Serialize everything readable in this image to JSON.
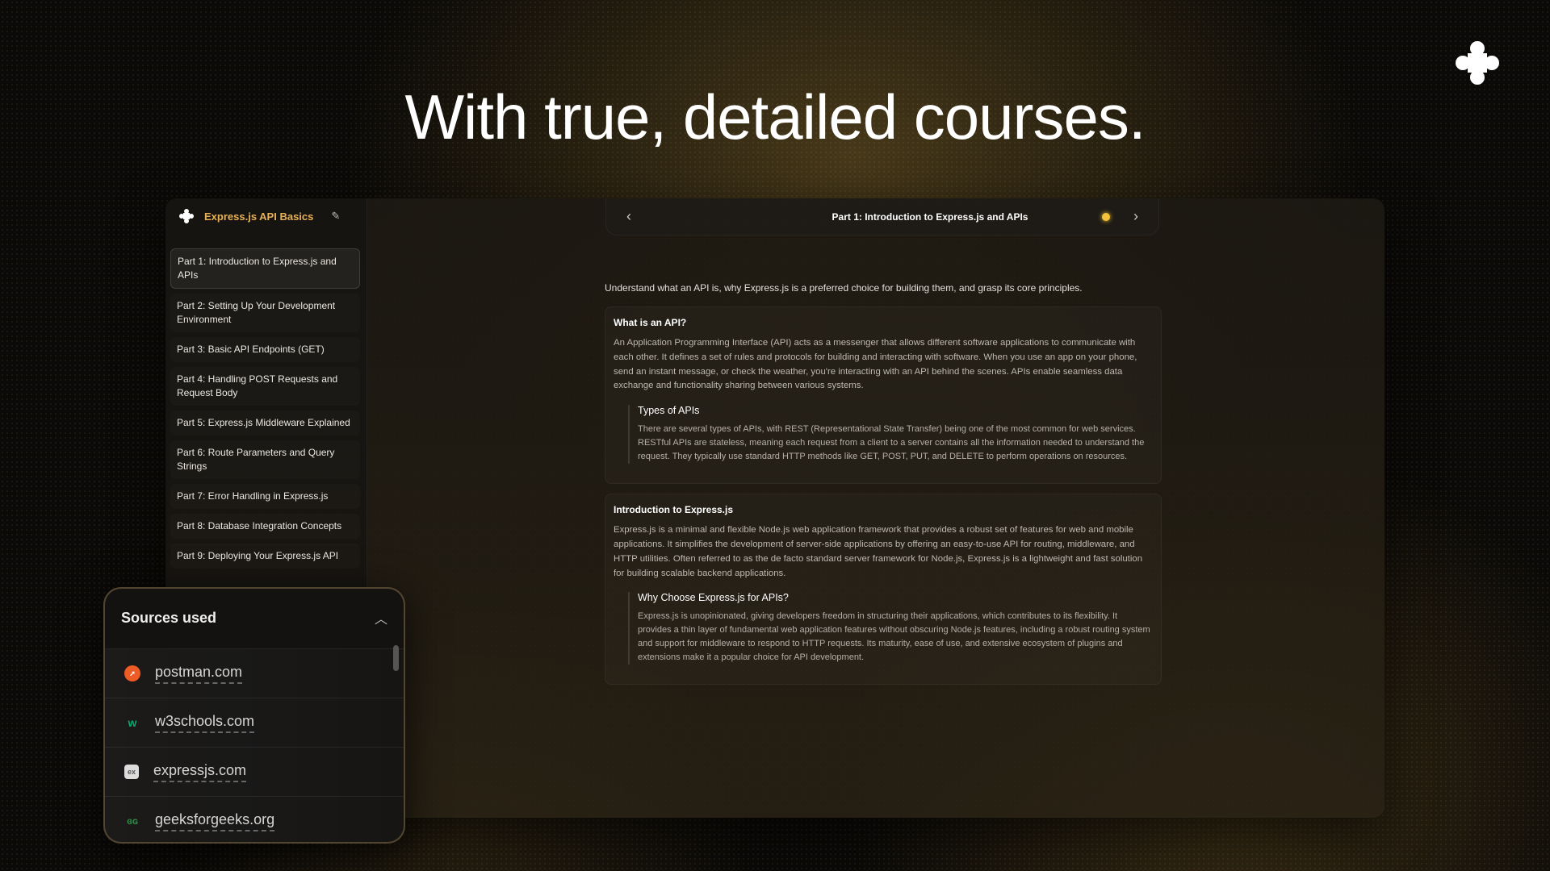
{
  "headline": "With true, detailed courses.",
  "brand": {
    "logo_icon": "four-petal-logo-icon"
  },
  "colors": {
    "accent": "#e7b057",
    "bulb": "#f4c33a",
    "postman": "#ef5b25",
    "w3schools": "#04aa6d",
    "gfg": "#2f8d46"
  },
  "sidebar": {
    "course_title": "Express.js API Basics",
    "edit_icon": "pencil-icon",
    "parts": [
      "Part 1: Introduction to Express.js and APIs",
      "Part 2: Setting Up Your Development Environment",
      "Part 3: Basic API Endpoints (GET)",
      "Part 4: Handling POST Requests and Request Body",
      "Part 5: Express.js Middleware Explained",
      "Part 6: Route Parameters and Query Strings",
      "Part 7: Error Handling in Express.js",
      "Part 8: Database Integration Concepts",
      "Part 9: Deploying Your Express.js API"
    ]
  },
  "topbar": {
    "title": "Part 1: Introduction to Express.js and APIs"
  },
  "content": {
    "intro": "Understand what an API is, why Express.js is a preferred choice for building them, and grasp its core principles.",
    "sections": [
      {
        "title": "What is an API?",
        "body": "An Application Programming Interface (API) acts as a messenger that allows different software applications to communicate with each other. It defines a set of rules and protocols for building and interacting with software. When you use an app on your phone, send an instant message, or check the weather, you're interacting with an API behind the scenes. APIs enable seamless data exchange and functionality sharing between various systems.",
        "sub_title": "Types of APIs",
        "sub_body": "There are several types of APIs, with REST (Representational State Transfer) being one of the most common for web services. RESTful APIs are stateless, meaning each request from a client to a server contains all the information needed to understand the request. They typically use standard HTTP methods like GET, POST, PUT, and DELETE to perform operations on resources."
      },
      {
        "title": "Introduction to Express.js",
        "body": "Express.js is a minimal and flexible Node.js web application framework that provides a robust set of features for web and mobile applications. It simplifies the development of server-side applications by offering an easy-to-use API for routing, middleware, and HTTP utilities. Often referred to as the de facto standard server framework for Node.js, Express.js is a lightweight and fast solution for building scalable backend applications.",
        "sub_title": "Why Choose Express.js for APIs?",
        "sub_body": "Express.js is unopinionated, giving developers freedom in structuring their applications, which contributes to its flexibility. It provides a thin layer of fundamental web application features without obscuring Node.js features, including a robust routing system and support for middleware to respond to HTTP requests. Its maturity, ease of use, and extensive ecosystem of plugins and extensions make it a popular choice for API development."
      }
    ]
  },
  "sources": {
    "title": "Sources used",
    "items": [
      {
        "label": "postman.com",
        "icon": "postman-favicon-icon"
      },
      {
        "label": "w3schools.com",
        "icon": "w3schools-favicon-icon"
      },
      {
        "label": "expressjs.com",
        "icon": "expressjs-favicon-icon"
      },
      {
        "label": "geeksforgeeks.org",
        "icon": "geeksforgeeks-favicon-icon"
      }
    ]
  }
}
